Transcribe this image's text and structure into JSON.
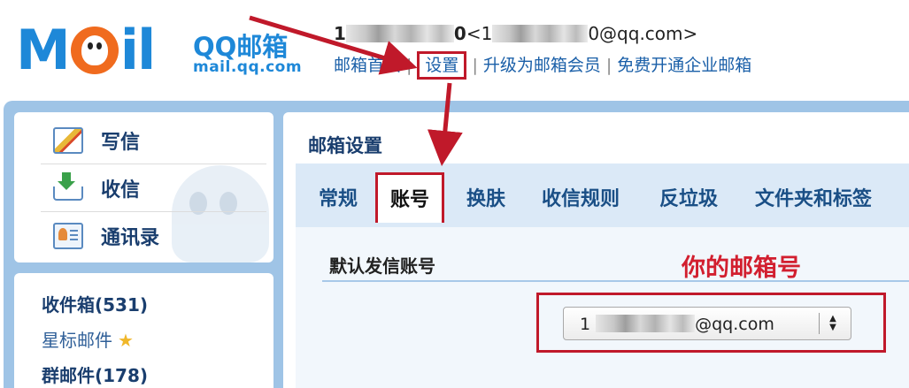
{
  "header": {
    "logo_word": "Mail",
    "brand": "QQ邮箱",
    "domain": "mail.qq.com",
    "user_name_prefix": "1",
    "user_name_suffix": "0",
    "email_prefix": "<1",
    "email_suffix": "0@qq.com>",
    "links": [
      "邮箱首页",
      "设置",
      "升级为邮箱会员",
      "免费开通企业邮箱"
    ],
    "link_separator": "|"
  },
  "sidebar": {
    "nav": [
      {
        "label": "写信",
        "icon": "compose-icon"
      },
      {
        "label": "收信",
        "icon": "inbox-download-icon"
      },
      {
        "label": "通讯录",
        "icon": "contacts-icon"
      }
    ],
    "folders": [
      {
        "label": "收件箱(531)"
      },
      {
        "label": "星标邮件",
        "icon": "star-icon",
        "icon_glyph": "★"
      },
      {
        "label": "群邮件(178)"
      }
    ]
  },
  "settings": {
    "title": "邮箱设置",
    "tabs": [
      "常规",
      "账号",
      "换肤",
      "收信规则",
      "反垃圾",
      "文件夹和标签"
    ],
    "active_tab": "账号",
    "section_title": "默认发信账号",
    "annotation": "你的邮箱号",
    "sender_select": {
      "value_prefix": "1",
      "value_suffix": "@qq.com"
    }
  },
  "colors": {
    "brand_blue": "#1e88d8",
    "highlight_red": "#c0192a",
    "frame_blue": "#9fc4e6",
    "link_blue": "#1a5fa8"
  }
}
